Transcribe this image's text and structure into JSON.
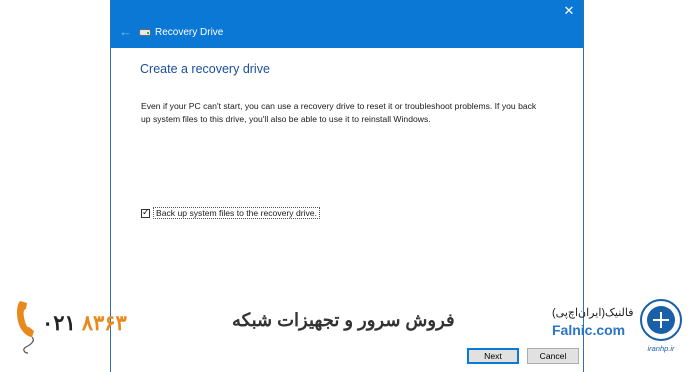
{
  "window": {
    "title": "Recovery Drive",
    "close_symbol": "✕",
    "back_symbol": "←"
  },
  "content": {
    "heading": "Create a recovery drive",
    "description": "Even if your PC can't start, you can use a recovery drive to reset it or troubleshoot problems. If you back up system files to this drive, you'll also be able to use it to reinstall Windows.",
    "checkbox": {
      "label": "Back up system files to the recovery drive.",
      "checked": true
    }
  },
  "buttons": {
    "next": "Next",
    "cancel": "Cancel"
  },
  "watermark": {
    "slogan": "فروش سرور و تجهیزات شبکه",
    "phone_prefix": "۰۲۱",
    "phone_number": "۸۳۶۳",
    "brand_fa": "فالنیک(ایران‌اچ‌پی)",
    "brand_en": "Falnic.com",
    "logo_caption": "iranhp.ir"
  },
  "colors": {
    "titlebar": "#0a78d4",
    "heading": "#1b4fa0",
    "accent": "#e8891d",
    "brand": "#2a74c9"
  }
}
